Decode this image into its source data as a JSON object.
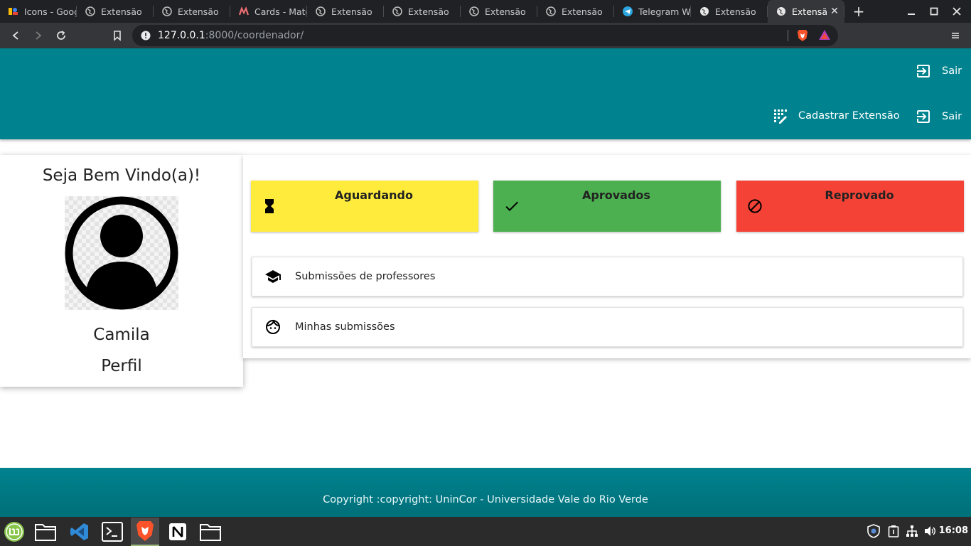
{
  "browser": {
    "tabs": [
      {
        "label": "Icons - Google Fonts",
        "icon": "google-fonts-icon"
      },
      {
        "label": "Extensão",
        "icon": "globe-icon"
      },
      {
        "label": "Extensão",
        "icon": "globe-icon"
      },
      {
        "label": "Cards - Materialize",
        "icon": "materialize-icon"
      },
      {
        "label": "Extensão",
        "icon": "globe-icon"
      },
      {
        "label": "Extensão",
        "icon": "globe-icon"
      },
      {
        "label": "Extensão",
        "icon": "globe-icon"
      },
      {
        "label": "Extensão",
        "icon": "globe-icon"
      },
      {
        "label": "Telegram Web",
        "icon": "telegram-icon"
      },
      {
        "label": "Extensão",
        "icon": "globe-icon"
      },
      {
        "label": "Extensão",
        "icon": "globe-icon",
        "active": true
      }
    ],
    "url_host": "127.0.0.1",
    "url_path": ":8000/coordenador/",
    "colors": {
      "tabbar": "#1f2124",
      "toolbar": "#35363a",
      "omnibox": "#202124"
    }
  },
  "header": {
    "logout_label_top": "Sair",
    "register_label": "Cadastrar Extensão",
    "logout_label": "Sair",
    "color": "#00838f"
  },
  "profile": {
    "welcome": "Seja Bem Vindo(a)!",
    "name": "Camila",
    "link_label": "Perfil"
  },
  "status_cards": [
    {
      "label": "Aguardando",
      "icon": "hourglass-icon",
      "color": "#ffeb3b"
    },
    {
      "label": "Aprovados",
      "icon": "check-icon",
      "color": "#4caf50"
    },
    {
      "label": "Reprovado",
      "icon": "block-icon",
      "color": "#f44336"
    }
  ],
  "list": [
    {
      "label": "Submissões de professores",
      "icon": "school-icon"
    },
    {
      "label": "Minhas submissões",
      "icon": "face-icon"
    }
  ],
  "footer": {
    "text": "Copyright :copyright: UninCor - Universidade Vale do Rio Verde"
  },
  "taskbar": {
    "clock": "16:08",
    "apps": [
      "mint-menu-icon",
      "files-icon",
      "vscode-icon",
      "terminal-icon",
      "brave-icon",
      "notion-icon",
      "folder-icon"
    ]
  }
}
